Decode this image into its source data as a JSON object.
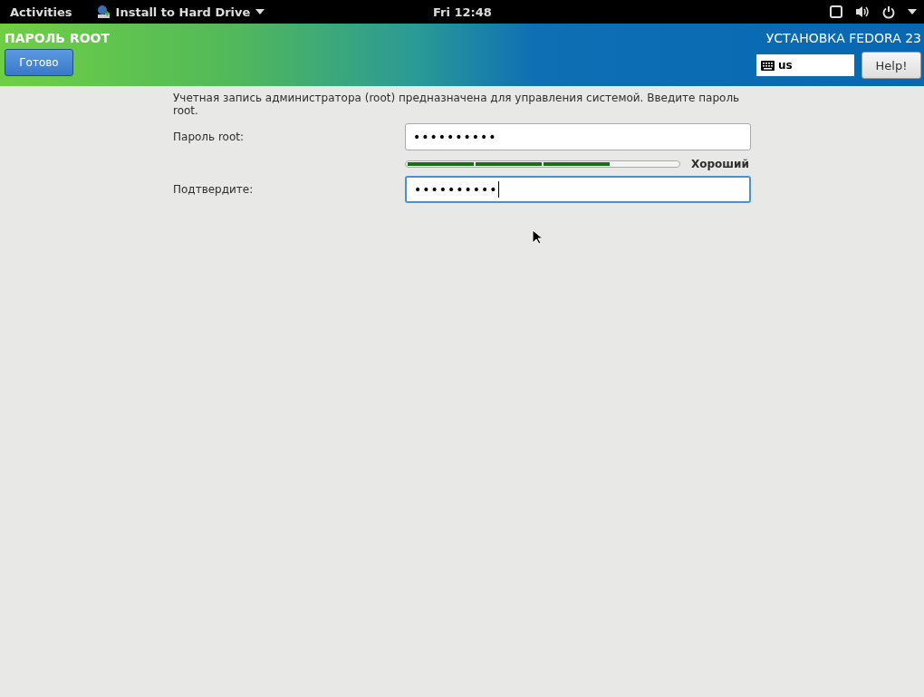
{
  "top_bar": {
    "activities": "Activities",
    "app_menu": "Install to Hard Drive",
    "clock": "Fri 12:48"
  },
  "header": {
    "title": "ПАРОЛЬ ROOT",
    "done_button": "Готово",
    "product": "УСТАНОВКА FEDORA 23",
    "keyboard_layout": "us",
    "help_button": "Help!"
  },
  "intro": "Учетная запись администратора (root) предназначена для управления системой. Введите пароль root.",
  "password": {
    "label": "Пароль root:",
    "value": "••••••••••",
    "focused": false
  },
  "strength": {
    "level": 0.75,
    "label": "Хороший"
  },
  "confirm": {
    "label": "Подтвердите:",
    "value": "••••••••••",
    "focused": true
  }
}
